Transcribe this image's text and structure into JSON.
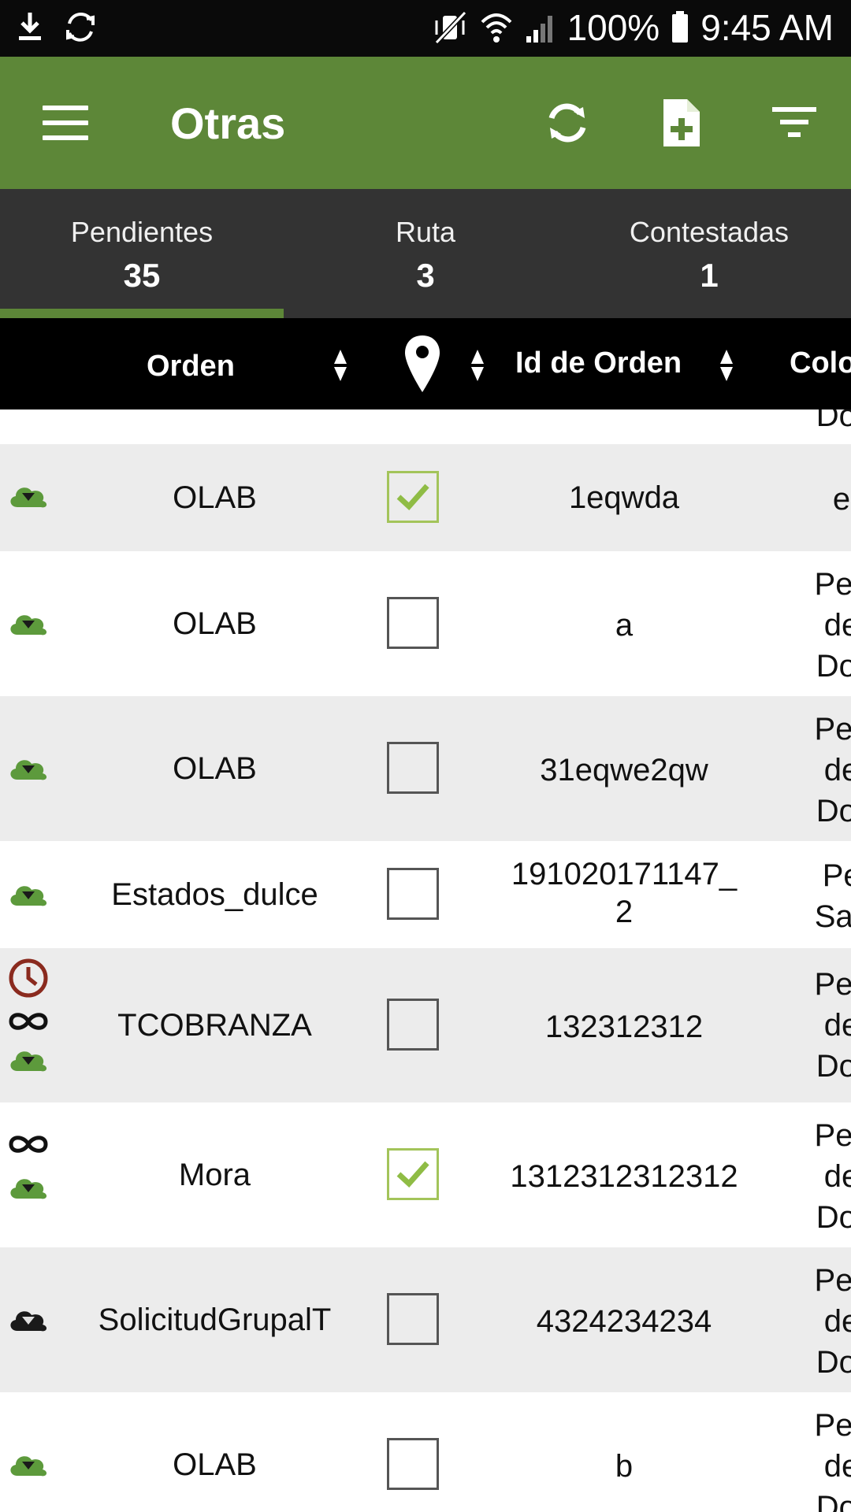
{
  "status_bar": {
    "battery": "100%",
    "time": "9:45 AM",
    "icons": [
      "download-icon",
      "sync-icon",
      "vibrate-off-icon",
      "wifi-icon",
      "signal-icon",
      "battery-icon"
    ]
  },
  "app_bar": {
    "title": "Otras",
    "actions": [
      "refresh-icon",
      "add-file-icon",
      "filter-icon"
    ],
    "color": "#5d8738"
  },
  "tabs": [
    {
      "label": "Pendientes",
      "count": "35",
      "active": true
    },
    {
      "label": "Ruta",
      "count": "3",
      "active": false
    },
    {
      "label": "Contestadas",
      "count": "1",
      "active": false
    }
  ],
  "table": {
    "headers": {
      "orden": "Orden",
      "location_icon": "location-pin-icon",
      "id_orden": "Id de Orden",
      "colonia_partial": "Colo"
    },
    "partial_top_col": "Dor",
    "rows": [
      {
        "icons": [
          "cloud-download-icon"
        ],
        "orden": "OLAB",
        "checked": true,
        "id": "1eqwda",
        "col": [
          "e"
        ]
      },
      {
        "icons": [
          "cloud-download-icon"
        ],
        "orden": "OLAB",
        "checked": false,
        "id": "a",
        "col": [
          "Pec",
          "de",
          "Dor"
        ]
      },
      {
        "icons": [
          "cloud-download-icon"
        ],
        "orden": "OLAB",
        "checked": false,
        "id": "31eqwe2qw",
        "col": [
          "Pec",
          "de",
          "Dor"
        ]
      },
      {
        "icons": [
          "cloud-download-icon"
        ],
        "orden": "Estados_dulce",
        "checked": false,
        "id": [
          "191020171147_",
          "2"
        ],
        "col": [
          "Pedr",
          "Santa"
        ]
      },
      {
        "icons": [
          "clock-icon",
          "infinity-icon",
          "cloud-download-icon"
        ],
        "orden": "TCOBRANZA",
        "checked": false,
        "id": "132312312",
        "col": [
          "Pec",
          "de",
          "Dor"
        ]
      },
      {
        "icons": [
          "infinity-icon",
          "cloud-download-icon"
        ],
        "orden": "Mora",
        "checked": true,
        "id": "1312312312312",
        "col": [
          "Pec",
          "de",
          "Dor"
        ]
      },
      {
        "icons": [
          "cloud-download-dark-icon"
        ],
        "orden": "SolicitudGrupalT",
        "checked": false,
        "id": "4324234234",
        "col": [
          "Pec",
          "de",
          "Dor"
        ]
      },
      {
        "icons": [
          "cloud-download-icon"
        ],
        "orden": "OLAB",
        "checked": false,
        "id": "b",
        "col": [
          "Pec",
          "de",
          "Dor"
        ]
      }
    ]
  }
}
